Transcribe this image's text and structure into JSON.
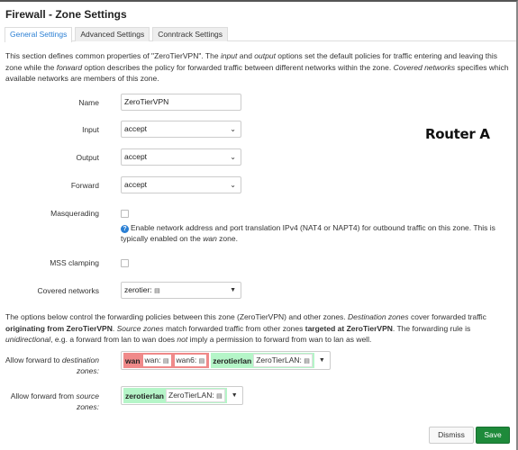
{
  "title": "Firewall - Zone Settings",
  "tabs": [
    {
      "label": "General Settings",
      "active": true
    },
    {
      "label": "Advanced Settings"
    },
    {
      "label": "Conntrack Settings"
    }
  ],
  "intro": {
    "p1": "This section defines common properties of \"ZeroTierVPN\". The ",
    "i1": "input",
    "p2": " and ",
    "i2": "output",
    "p3": " options set the default policies for traffic entering and leaving this zone while the ",
    "i3": "forward",
    "p4": " option describes the policy for forwarded traffic between different networks within the zone. ",
    "i4": "Covered networks",
    "p5": " specifies which available networks are members of this zone."
  },
  "fields": {
    "name": {
      "label": "Name",
      "value": "ZeroTierVPN"
    },
    "input": {
      "label": "Input",
      "value": "accept"
    },
    "output": {
      "label": "Output",
      "value": "accept"
    },
    "forward": {
      "label": "Forward",
      "value": "accept"
    },
    "masq": {
      "label": "Masquerading",
      "checked": false,
      "help1": "Enable network address and port translation IPv4 (NAT4 or NAPT4) for outbound traffic on this zone. This is typically enabled on the ",
      "help_i": "wan",
      "help2": " zone."
    },
    "mss": {
      "label": "MSS clamping",
      "checked": false
    },
    "covered": {
      "label": "Covered networks",
      "value": "zerotier:"
    }
  },
  "forwarding": {
    "p1": "The options below control the forwarding policies between this zone (ZeroTierVPN) and other zones. ",
    "i1": "Destination zones",
    "p2": " cover forwarded traffic ",
    "b1": "originating from ZeroTierVPN",
    "p3": ". ",
    "i2": "Source zones",
    "p4": " match forwarded traffic from other zones ",
    "b2": "targeted at ZeroTierVPN",
    "p5": ". The forwarding rule is ",
    "i3": "unidirectional",
    "p6": ", e.g. a forward from lan to wan does ",
    "i4": "not",
    "p7": " imply a permission to forward from wan to lan as well."
  },
  "dest": {
    "label1": "Allow forward to ",
    "label_i": "destination zones:",
    "zones": [
      {
        "name": "wan",
        "color": "#f08a8a",
        "nets": [
          "wan:",
          "wan6:"
        ]
      },
      {
        "name": "zerotierlan",
        "color": "#b5f5c8",
        "nets": [
          "ZeroTierLAN:"
        ]
      }
    ]
  },
  "src": {
    "label1": "Allow forward from ",
    "label_i": "source zones:",
    "zones": [
      {
        "name": "zerotierlan",
        "color": "#b5f5c8",
        "nets": [
          "ZeroTierLAN:"
        ]
      }
    ]
  },
  "buttons": {
    "dismiss": "Dismiss",
    "save": "Save"
  },
  "overlay": "Router A",
  "colors": {
    "accent": "#2a7fd4",
    "save": "#1e8a3a"
  }
}
